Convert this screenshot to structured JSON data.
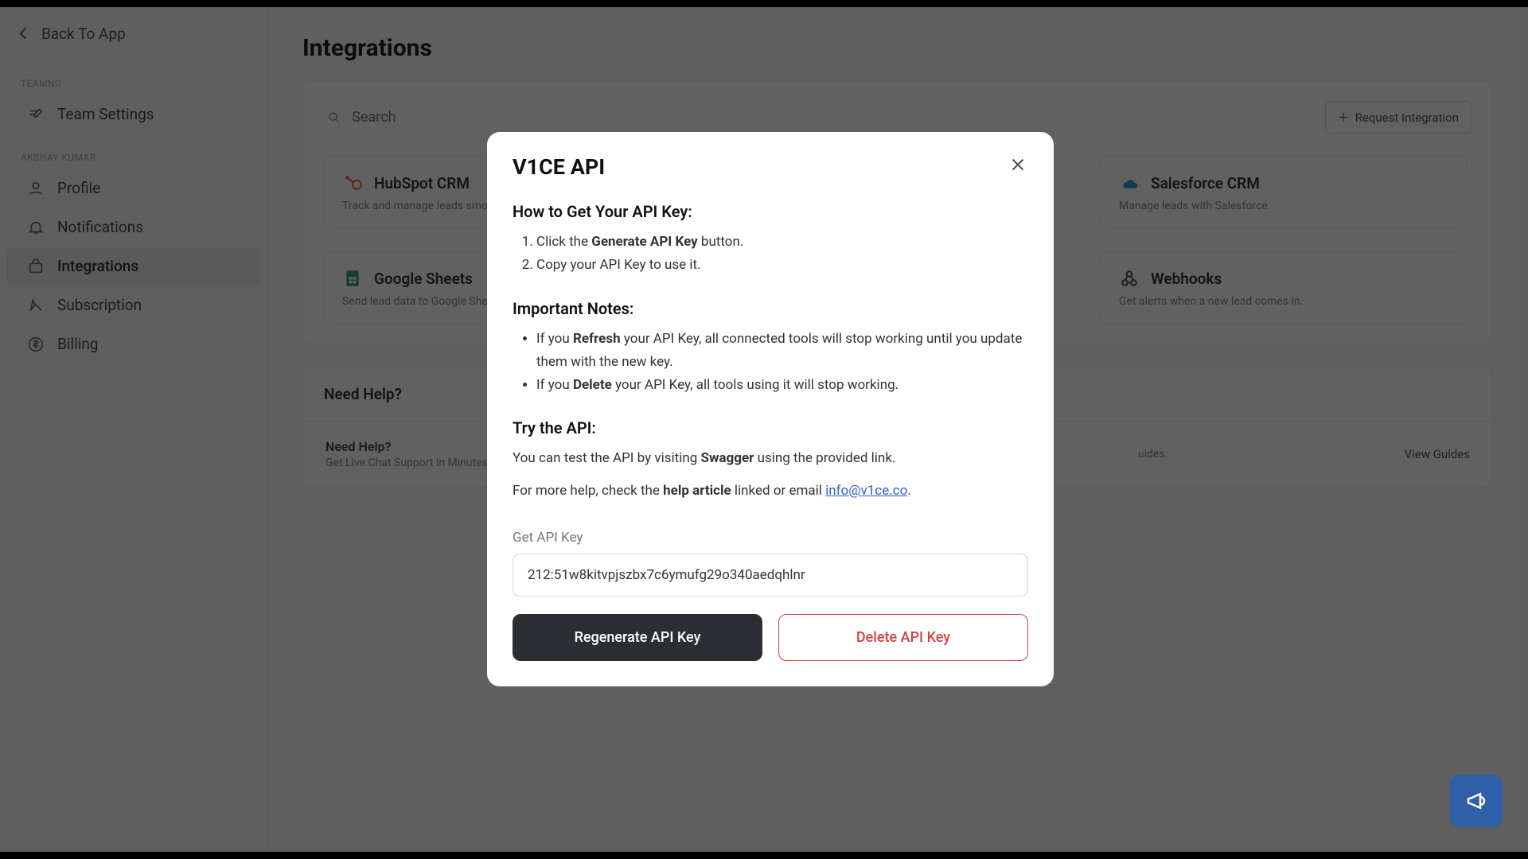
{
  "back_label": "Back To App",
  "sections": {
    "team": "TEAMNG",
    "user": "AKSHAY KUMAR"
  },
  "nav": {
    "team_settings": "Team Settings",
    "profile": "Profile",
    "notifications": "Notifications",
    "integrations": "Integrations",
    "subscription": "Subscription",
    "billing": "Billing"
  },
  "page_title": "Integrations",
  "search_placeholder": "Search",
  "request_integration": "Request Integration",
  "cards": {
    "hubspot": {
      "title": "HubSpot CRM",
      "desc": "Track and manage leads smoothly."
    },
    "salesforce": {
      "title": "Salesforce CRM",
      "desc": "Manage leads with Salesforce."
    },
    "sheets": {
      "title": "Google Sheets",
      "desc": "Send lead data to Google Sheets."
    },
    "webhooks": {
      "title": "Webhooks",
      "desc": "Get alerts when a new lead comes in."
    }
  },
  "help": {
    "panel_title": "Need Help?",
    "card_title": "Need Help?",
    "card_sub": "Get Live Chat Support in Minutes",
    "guides_sub": "uides.",
    "view_guides": "View Guides"
  },
  "modal": {
    "title": "V1CE API",
    "h_get": "How to Get Your API Key:",
    "step1_a": "Click the ",
    "step1_b": "Generate API Key",
    "step1_c": " button.",
    "step2": "Copy your API Key to use it.",
    "h_notes": "Important Notes:",
    "note1_a": "If you ",
    "note1_b": "Refresh",
    "note1_c": " your API Key, all connected tools will stop working until you update them with the new key.",
    "note2_a": "If you ",
    "note2_b": "Delete",
    "note2_c": " your API Key, all tools using it will stop working.",
    "h_try": "Try the API:",
    "try_a": "You can test the API by visiting ",
    "try_b": "Swagger",
    "try_c": " using the provided link.",
    "help_a": "For more help, check the ",
    "help_b": "help article",
    "help_c": " linked or email ",
    "email": "info@v1ce.co",
    "help_d": ".",
    "key_label": "Get API Key",
    "key_value": "212:51w8kitvpjszbx7c6ymufg29o340aedqhlnr",
    "regen": "Regenerate API Key",
    "delete": "Delete API Key"
  }
}
